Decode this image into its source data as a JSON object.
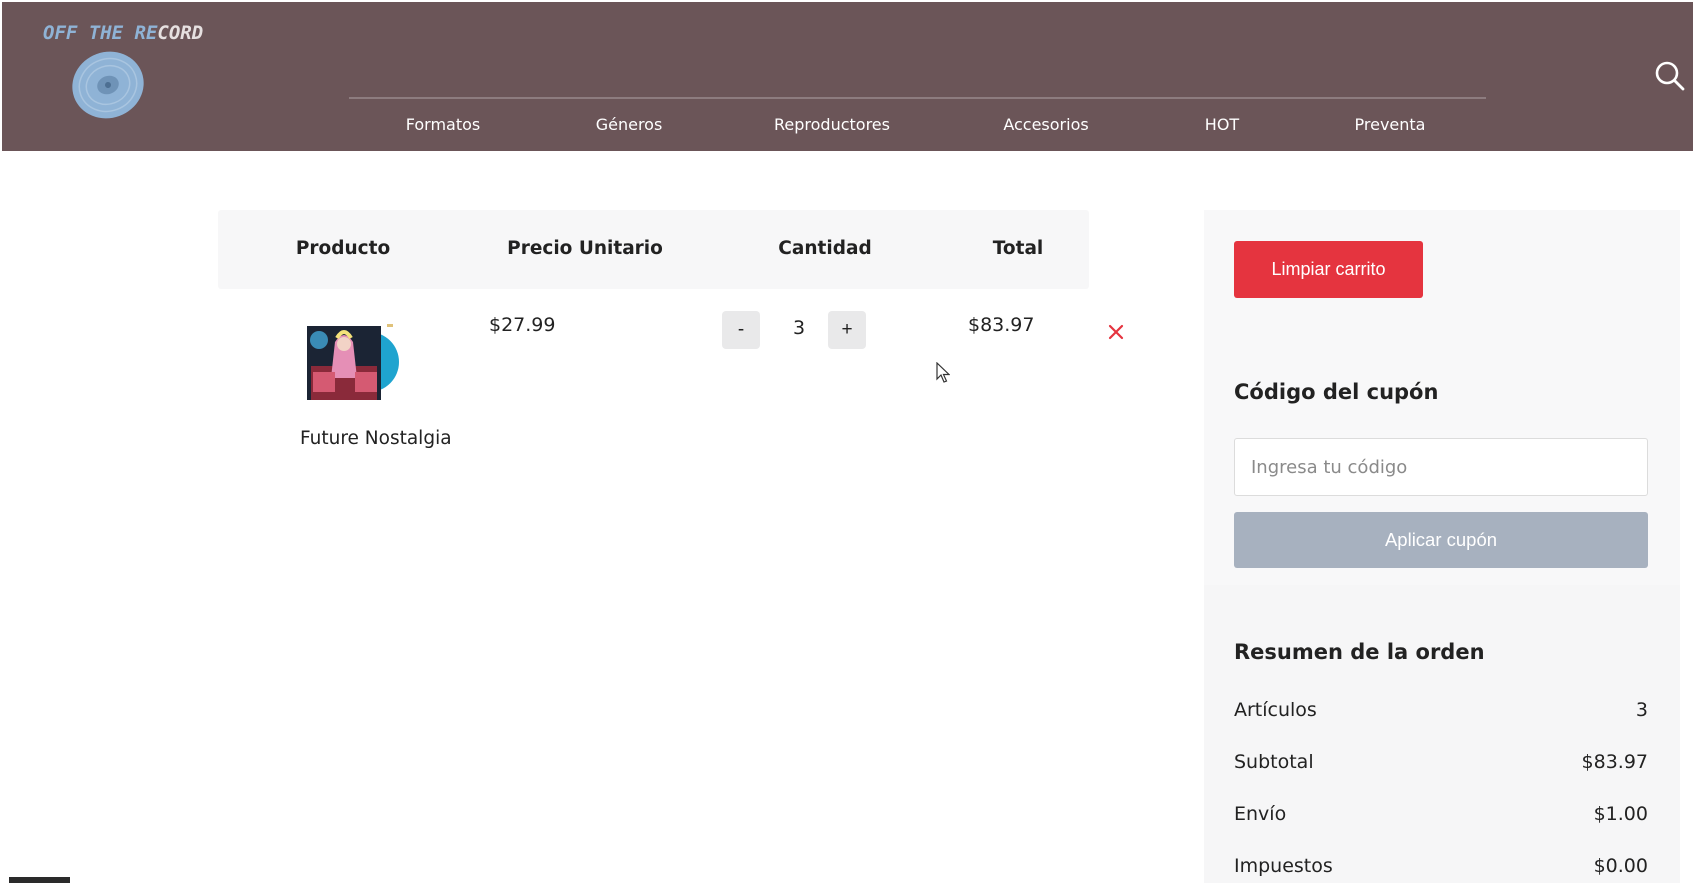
{
  "brand": {
    "logo_part1": "OFF THE RE",
    "logo_part2": "CORD",
    "colors": {
      "header": "#6b5558",
      "logo_blue": "#8fb3d6",
      "danger": "#e5343f",
      "apply_button": "#a7b1bf"
    }
  },
  "nav": {
    "items": [
      {
        "label": "Formatos"
      },
      {
        "label": "Géneros"
      },
      {
        "label": "Reproductores"
      },
      {
        "label": "Accesorios"
      },
      {
        "label": "HOT"
      },
      {
        "label": "Preventa"
      }
    ],
    "search_icon": "search-icon"
  },
  "cart": {
    "headers": {
      "product": "Producto",
      "unit_price": "Precio Unitario",
      "quantity": "Cantidad",
      "total": "Total"
    },
    "items": [
      {
        "name": "Future Nostalgia",
        "unit_price": "$27.99",
        "quantity": "3",
        "decrement_label": "-",
        "increment_label": "+",
        "total": "$83.97",
        "remove_icon": "close-icon"
      }
    ]
  },
  "sidebar": {
    "clear_cart_label": "Limpiar carrito",
    "coupon": {
      "title": "Código del cupón",
      "placeholder": "Ingresa tu código",
      "value": "",
      "apply_label": "Aplicar cupón"
    },
    "summary": {
      "title": "Resumen de la orden",
      "rows": [
        {
          "label": "Artículos",
          "value": "3"
        },
        {
          "label": "Subtotal",
          "value": "$83.97"
        },
        {
          "label": "Envío",
          "value": "$1.00"
        },
        {
          "label": "Impuestos",
          "value": "$0.00"
        }
      ]
    }
  }
}
